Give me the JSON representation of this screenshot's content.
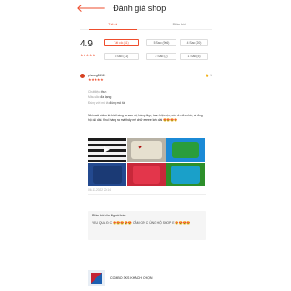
{
  "header": {
    "back_icon": "arrow-left-icon",
    "title": "Đánh giá shop"
  },
  "tabs": [
    "Tất cả",
    "Phản hồi"
  ],
  "summary": {
    "average": "4.9",
    "filters": [
      "Tất cả (41)",
      "5 Sao (966)",
      "4 Sao (20)",
      "3 Sao (11)",
      "2 Sao (2)",
      "1 Sao (5)"
    ],
    "stars": "★★★★★"
  },
  "review": {
    "username": "phuong26119",
    "stars": "★★★★★",
    "like_icon": "thumbs-up-icon",
    "likes": "1",
    "attrs": [
      {
        "label": "Chất liệu:",
        "value": "thun"
      },
      {
        "label": "Màu sắc:",
        "value": "đa dạng"
      },
      {
        "label": "Đúng với mô tả:",
        "value": "đúng mô tả"
      }
    ],
    "text": "Nhìn cái video là biết hàng ra sao rồi, hàng đẹp, toàn hiệu xịn, còn rẻ nữa chứ, sẽ ủng hộ dài dài. Khui hàng ra mà thấy mê chữ eeeee kéo dài 😍😍😍😍",
    "photos": [
      "video",
      "img2",
      "img3",
      "img4",
      "img5",
      "img6"
    ],
    "date": "06-11-2022 20:14"
  },
  "reply": {
    "label": "Phản hồi của Người bán:",
    "text": "YÊU QUÁ Đ C 😍😍😍😍😍 CẢM ƠN C ỦNG HỘ SHOP E 😍😍😍😍"
  },
  "product": {
    "name": "COMBO 3KS KHÁCH CHỌN"
  }
}
